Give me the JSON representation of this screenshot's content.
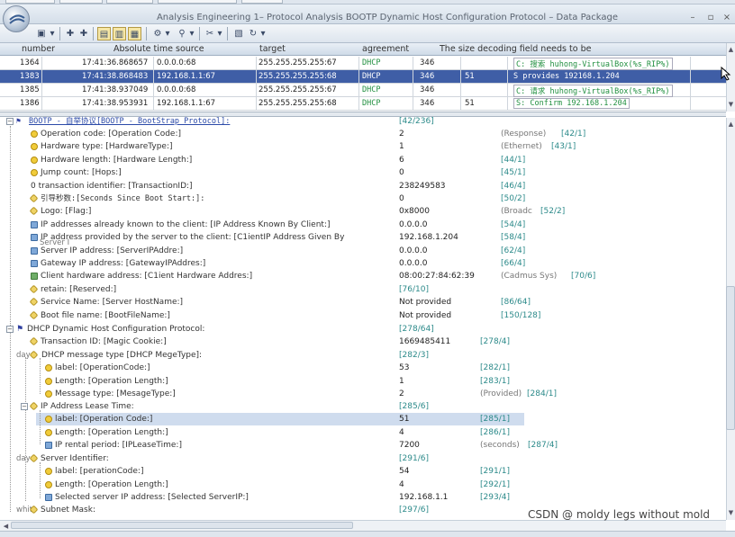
{
  "window": {
    "title": "Analysis Engineering 1– Protocol Analysis BOOTP Dynamic Host Configuration Protocol – Data Package",
    "controls": [
      "–",
      "▫",
      "×"
    ]
  },
  "packet_list": {
    "columns": [
      "number",
      "Absolute time source",
      "target",
      "agreement",
      "The size decoding field needs to be"
    ],
    "rows": [
      {
        "num": "1364",
        "time": "17:41:36.868657",
        "src": "0.0.0.0:68",
        "dst": "255.255.255.255:67",
        "proto": "DHCP",
        "size": "346",
        "extra": "",
        "info": "C: 搜索 huhong-VirtualBox(%s_RIP%)",
        "selected": false
      },
      {
        "num": "1383",
        "time": "17:41:38.868483",
        "src": "192.168.1.1:67",
        "dst": "255.255.255.255:68",
        "proto": "DHCP",
        "size": "346",
        "extra": "51",
        "info": "S provides 192168.1.204",
        "selected": true
      },
      {
        "num": "1385",
        "time": "17:41:38.937049",
        "src": "0.0.0.0:68",
        "dst": "255.255.255.255:67",
        "proto": "DHCP",
        "size": "346",
        "extra": "",
        "info": "C: 请求 huhong-VirtualBox(%s_RIP%)",
        "selected": false
      },
      {
        "num": "1386",
        "time": "17:41:38.953931",
        "src": "192.168.1.1:67",
        "dst": "255.255.255.255:68",
        "proto": "DHCP",
        "size": "346",
        "extra": "51",
        "info": "S: Confirm 192.168.1.204",
        "selected": false
      }
    ]
  },
  "tree": {
    "bootp_header": {
      "label": "BOOTP - 自举协议[BOOTP - BootStrap Protocol]:",
      "offset": "[42/236]"
    },
    "bootp_fields": [
      {
        "label": "Operation code: [Operation Code:]",
        "value": "2",
        "meaning": "(Response)",
        "offset": "[42/1]"
      },
      {
        "label": "Hardware type: [HardwareType:]",
        "value": "1",
        "meaning": "(Ethernet)",
        "offset": "[43/1]"
      },
      {
        "label": "Hardware length: [Hardware Length:]",
        "value": "6",
        "meaning": "",
        "offset": "[44/1]"
      },
      {
        "label": "Jump count: [Hops:]",
        "value": "0",
        "meaning": "",
        "offset": "[45/1]"
      },
      {
        "label": "0 transaction identifier: [TransactionID:]",
        "value": "238249583",
        "meaning": "",
        "offset": "[46/4]"
      },
      {
        "label": "引导秒数:[Seconds Since Boot Start:]:",
        "value": "0",
        "meaning": "",
        "offset": "[50/2]"
      },
      {
        "label": "Logo: [Flag:]",
        "value": "0x8000",
        "meaning": "(Broadc",
        "offset": "[52/2]"
      },
      {
        "label": "IP addresses already known to the client: [IP Address Known By Client:]",
        "value": "0.0.0.0",
        "meaning": "",
        "offset": "[54/4]"
      },
      {
        "label": "IP address provided by the server to the client: [C1ientIP Address Given By",
        "value": "192.168.1.204",
        "meaning": "",
        "offset": "[58/4]"
      },
      {
        "label": "Server IP address: [ServerIPAddre:]",
        "value": "0.0.0.0",
        "meaning": "",
        "offset": "[62/4]"
      },
      {
        "label": "Gateway IP address: [GatewayIPAddres:]",
        "value": "0.0.0.0",
        "meaning": "",
        "offset": "[66/4]"
      },
      {
        "label": "Client hardware address: [C1ient Hardware Addres:]",
        "value": "08:00:27:84:62:39",
        "meaning": "(Cadmus Sys)",
        "offset": "[70/6]"
      },
      {
        "label": "retain: [Reserved:]",
        "value": "",
        "meaning": "",
        "offset": "[76/10]"
      },
      {
        "label": "Service Name: [Server HostName:]",
        "value": "Not provided",
        "meaning": "",
        "offset": "[86/64]"
      },
      {
        "label": "Boot file name: [BootFileName:]",
        "value": "Not provided",
        "meaning": "",
        "offset": "[150/128]"
      }
    ],
    "server_overlap": "Server I",
    "dhcp_header": {
      "label": "DHCP Dynamic Host Configuration Protocol:",
      "offset": "[278/64]"
    },
    "magic": {
      "label": "Transaction ID: [Magic Cookie:]",
      "value": "1669485411",
      "offset": "[278/4]"
    },
    "msgtype": {
      "prefix": "day",
      "label": "DHCP message type [DHCP MegeType]:",
      "offset": "[282/3]"
    },
    "msgtype_fields": [
      {
        "label": "label: [OperationCode:]",
        "value": "53",
        "meaning": "",
        "offset": "[282/1]"
      },
      {
        "label": "Length: [Operation Length:]",
        "value": "1",
        "meaning": "",
        "offset": "[283/1]"
      },
      {
        "label": "Message type: [MesageType:]",
        "value": "2",
        "meaning": "(Provided)",
        "offset": "[284/1]"
      }
    ],
    "lease": {
      "label": "IP Address Lease Time:",
      "offset": "[285/6]"
    },
    "lease_fields": [
      {
        "label": "label: [Operation Code:]",
        "value": "51",
        "meaning": "",
        "offset": "[285/1]"
      },
      {
        "label": "Length: [Operation Length:]",
        "value": "4",
        "meaning": "",
        "offset": "[286/1]"
      },
      {
        "label": "IP rental period: [IPLeaseTime:]",
        "value": "7200",
        "meaning": "(seconds)",
        "offset": "[287/4]"
      }
    ],
    "server_id": {
      "prefix": "day",
      "label": "Server Identifier:",
      "offset": "[291/6]"
    },
    "server_id_fields": [
      {
        "label": "label: [perationCode:]",
        "value": "54",
        "meaning": "",
        "offset": "[291/1]"
      },
      {
        "label": "Length: [Operation Length:]",
        "value": "4",
        "meaning": "",
        "offset": "[292/1]"
      },
      {
        "label": "Selected server IP address: [Selected ServerIP:]",
        "value": "192.168.1.1",
        "meaning": "",
        "offset": "[293/4]"
      }
    ],
    "subnet": {
      "prefix": "whit",
      "label": "Subnet Mask:",
      "offset": "[297/6]"
    }
  },
  "watermark": "CSDN @ moldy legs without mold"
}
